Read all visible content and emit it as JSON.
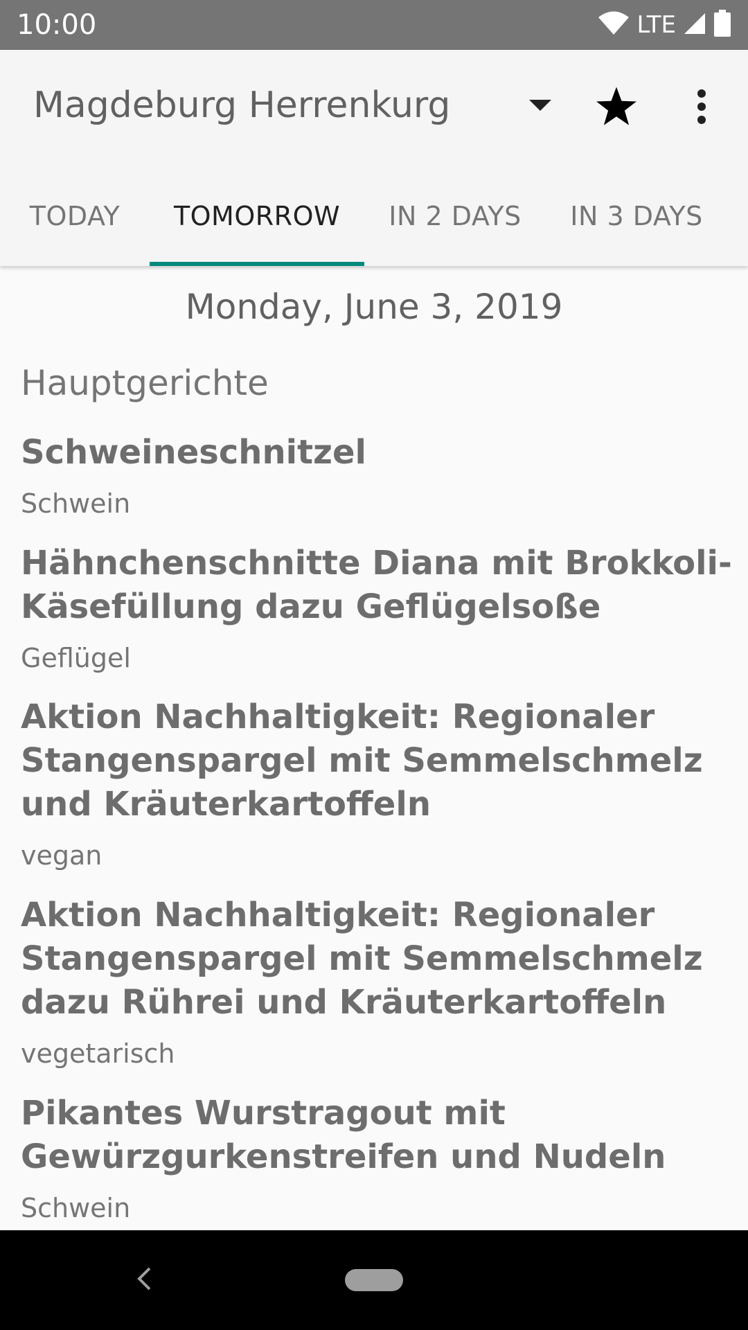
{
  "status_bar": {
    "time": "10:00",
    "network": "LTE"
  },
  "toolbar": {
    "location": "Magdeburg Herrenkurg",
    "icons": [
      "dropdown-arrow",
      "star",
      "more-vert"
    ]
  },
  "tabs": [
    {
      "label": "TODAY",
      "selected": false
    },
    {
      "label": "TOMORROW",
      "selected": true
    },
    {
      "label": "IN 2 DAYS",
      "selected": false
    },
    {
      "label": "IN 3 DAYS",
      "selected": false
    }
  ],
  "accent_color": "#00897b",
  "menu": {
    "date": "Monday, June 3, 2019",
    "category": "Hauptgerichte",
    "meals": [
      {
        "name": "Schweineschnitzel",
        "type": "Schwein"
      },
      {
        "name": "Hähnchenschnitte Diana mit Brokkoli-Käsefüllung dazu Geflügelsoße",
        "type": "Geflügel"
      },
      {
        "name": "Aktion Nachhaltigkeit: Regionaler Stangenspargel mit Semmelschmelz und Kräuterkartoffeln",
        "type": "vegan"
      },
      {
        "name": "Aktion Nachhaltigkeit: Regionaler Stangenspargel mit Semmelschmelz dazu Rührei und Kräuterkartoffeln",
        "type": "vegetarisch"
      },
      {
        "name": "Pikantes Wurstragout mit Gewürzgurkenstreifen und Nudeln",
        "type": "Schwein"
      }
    ]
  }
}
